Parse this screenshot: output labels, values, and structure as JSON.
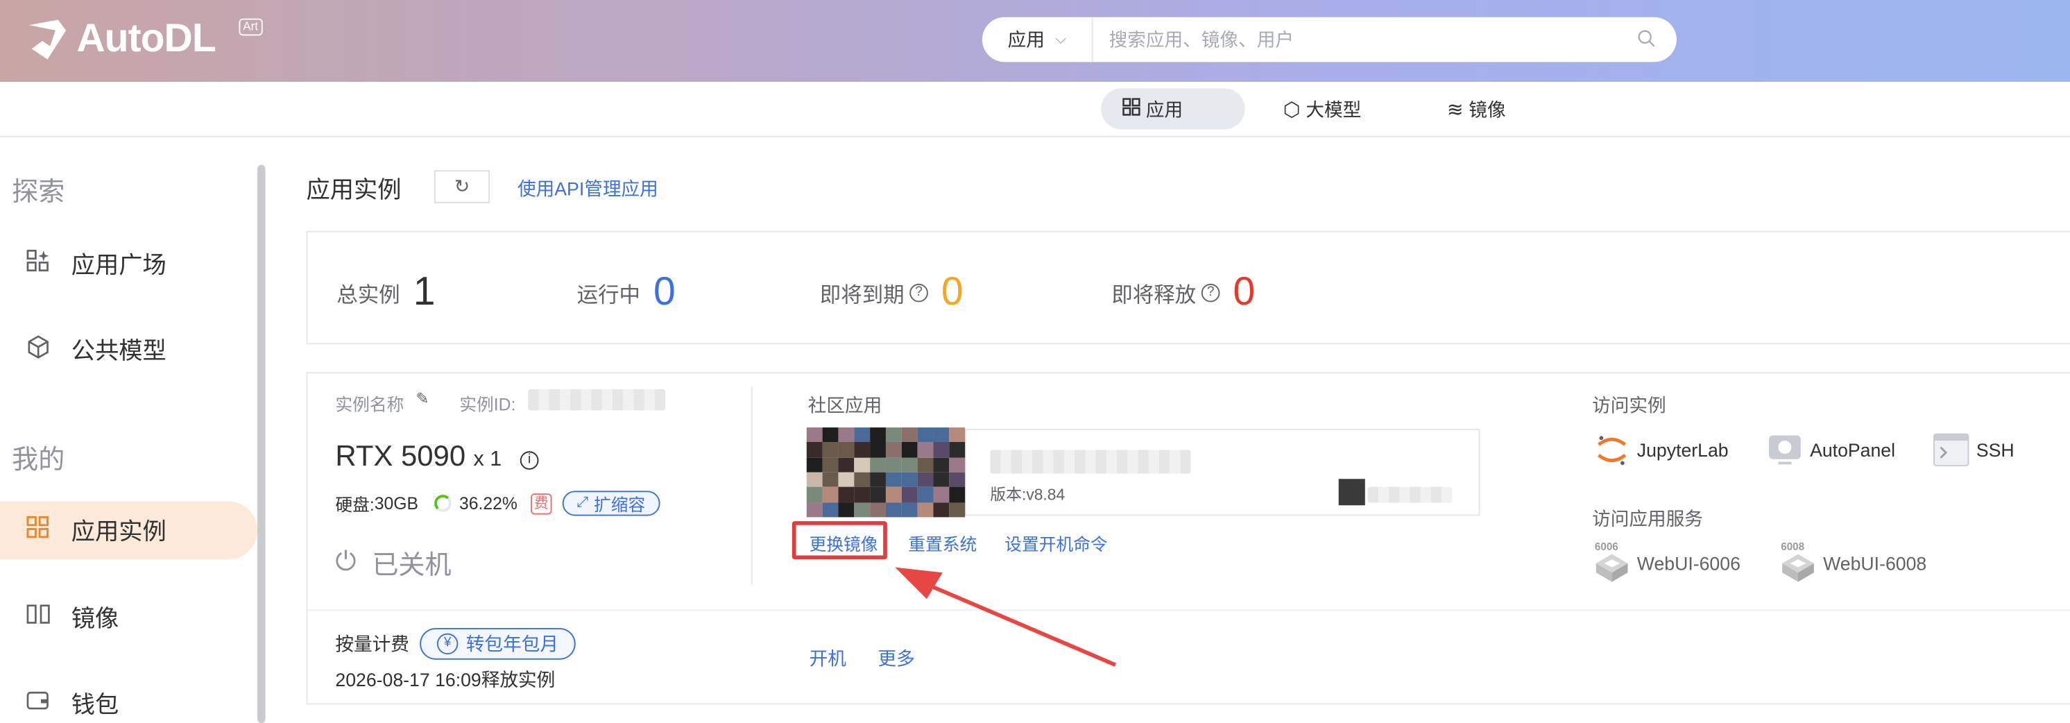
{
  "header": {
    "logo_text": "AutoDL",
    "logo_badge": "Art"
  },
  "search": {
    "scope": "应用",
    "placeholder": "搜索应用、镜像、用户"
  },
  "tabs": [
    {
      "label": "应用",
      "icon": "grid-icon"
    },
    {
      "label": "大模型",
      "icon": "cube-icon"
    },
    {
      "label": "镜像",
      "icon": "stack-icon"
    }
  ],
  "sidebar": {
    "explore_title": "探索",
    "mine_title": "我的",
    "items": [
      {
        "label": "应用广场",
        "icon": "apps-sparkle-icon"
      },
      {
        "label": "公共模型",
        "icon": "cube-icon"
      },
      {
        "label": "应用实例",
        "icon": "grid-icon",
        "active": true
      },
      {
        "label": "镜像",
        "icon": "image-icon"
      },
      {
        "label": "钱包",
        "icon": "wallet-icon"
      }
    ]
  },
  "page": {
    "title": "应用实例",
    "api_link": "使用API管理应用"
  },
  "stats": [
    {
      "label": "总实例",
      "value": "1",
      "color": "#303133"
    },
    {
      "label": "运行中",
      "value": "0",
      "color": "#3c6fe0"
    },
    {
      "label": "即将到期",
      "value": "0",
      "color": "#f5a623",
      "help": "?"
    },
    {
      "label": "即将释放",
      "value": "0",
      "color": "#e6382b",
      "help": "?"
    }
  ],
  "instance": {
    "name_label": "实例名称",
    "id_label": "实例ID:",
    "gpu": "RTX 5090",
    "gpu_count": "x 1",
    "disk_label": "硬盘:",
    "disk_size": "30GB",
    "disk_usage": "36.22%",
    "disk_usage_fraction": 0.3622,
    "fee_badge": "费",
    "expand_label": "扩缩容",
    "status": "已关机",
    "community_title": "社区应用",
    "version": "版本:v8.84",
    "actions": [
      "更换镜像",
      "重置系统",
      "设置开机命令"
    ],
    "access_title": "访问实例",
    "access": [
      {
        "label": "JupyterLab",
        "icon": "jupyter-icon"
      },
      {
        "label": "AutoPanel",
        "icon": "panel-icon"
      },
      {
        "label": "SSH",
        "icon": "terminal-icon"
      }
    ],
    "service_title": "访问应用服务",
    "services": [
      {
        "label": "WebUI-6006",
        "badge": "6006",
        "icon": "service-cube-icon"
      },
      {
        "label": "WebUI-6008",
        "badge": "6008",
        "icon": "service-cube-icon"
      }
    ],
    "billing_label": "按量计费",
    "convert_label": "转包年包月",
    "release_text": "2026-08-17 16:09释放实例",
    "bottom_actions": [
      "开机",
      "更多"
    ]
  },
  "colors": {
    "accent": "#3c6fe0",
    "highlight": "#e03e3e",
    "active_bg": "#fde9d8",
    "active_icon": "#e6882e"
  }
}
